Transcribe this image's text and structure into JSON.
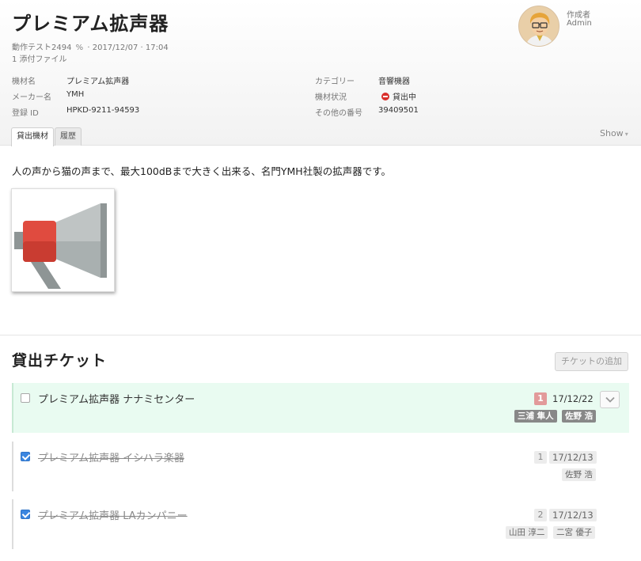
{
  "equipment": {
    "title": "プレミアム拡声器",
    "meta_test": "動作テスト2494",
    "meta_date": "2017/12/07 · 17:04",
    "meta_separator": "·",
    "attachments": "1 添付ファイル",
    "description": "人の声から猫の声まで、最大100dBまで大きく出来る、名門YMH社製の拡声器です。",
    "image_icon": "megaphone-icon"
  },
  "author": {
    "label": "作成者",
    "name": "Admin",
    "avatar_icon": "avatar-icon"
  },
  "properties": {
    "name_label": "機材名",
    "name_value": "プレミアム拡声器",
    "maker_label": "メーカー名",
    "maker_value": "YMH",
    "id_label": "登録 ID",
    "id_value": "HPKD-9211-94593",
    "category_label": "カテゴリー",
    "category_value": "音響機器",
    "status_label": "機材状況",
    "status_value": "貸出中",
    "status_color": "#d9302c",
    "other_label": "その他の番号",
    "other_value": "39409501"
  },
  "tabs": [
    {
      "label": "貸出機材",
      "active": true
    },
    {
      "label": "履歴",
      "active": false
    }
  ],
  "show_label": "Show",
  "tickets_section": {
    "title": "貸出チケット",
    "add_button": "チケットの追加",
    "tickets": [
      {
        "title": "プレミアム拡声器 ナナミセンター",
        "checked": false,
        "count": "1",
        "date": "17/12/22",
        "tags": [
          "三浦 隼人",
          "佐野 浩"
        ]
      },
      {
        "title": "プレミアム拡声器 イシハラ楽器",
        "checked": true,
        "count": "1",
        "date": "17/12/13",
        "tags": [
          "佐野 浩"
        ]
      },
      {
        "title": "プレミアム拡声器 LAカンパニー",
        "checked": true,
        "count": "2",
        "date": "17/12/13",
        "tags": [
          "山田 淳二",
          "二宮 優子"
        ]
      }
    ]
  },
  "colors": {
    "active_ticket_bg": "#e9fbf1",
    "alert_badge": "#e29a9a",
    "dark_tag": "#888888",
    "checkbox_blue": "#3b86e0"
  }
}
